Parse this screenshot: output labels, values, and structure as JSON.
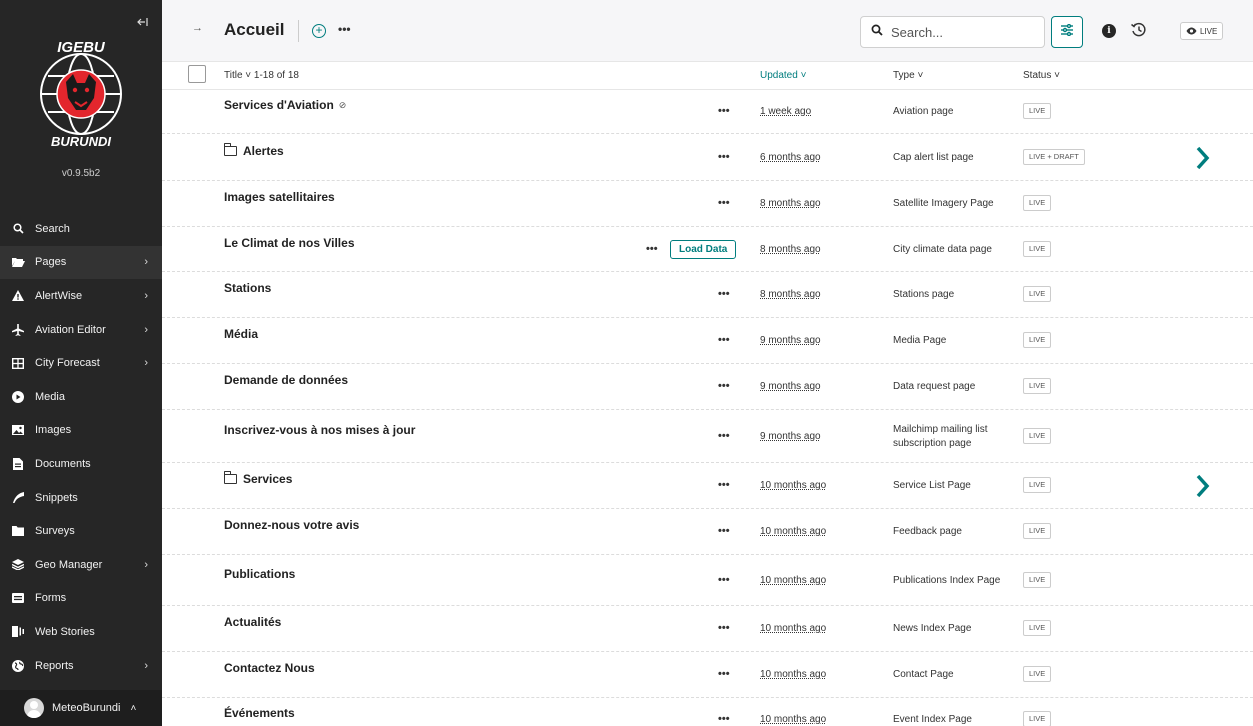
{
  "sidebar": {
    "collapse_icon": "collapse-left-icon",
    "logo_top_text": "IGEBU",
    "logo_bottom_text": "BURUNDI",
    "version": "v0.9.5b2",
    "items": [
      {
        "label": "Search",
        "icon": "search-icon",
        "chevron": false
      },
      {
        "label": "Pages",
        "icon": "folder-open-icon",
        "chevron": true
      },
      {
        "label": "AlertWise",
        "icon": "warning-icon",
        "chevron": true
      },
      {
        "label": "Aviation Editor",
        "icon": "plane-icon",
        "chevron": true
      },
      {
        "label": "City Forecast",
        "icon": "table-icon",
        "chevron": true
      },
      {
        "label": "Media",
        "icon": "media-icon",
        "chevron": false
      },
      {
        "label": "Images",
        "icon": "image-icon",
        "chevron": false
      },
      {
        "label": "Documents",
        "icon": "document-icon",
        "chevron": false
      },
      {
        "label": "Snippets",
        "icon": "snippet-icon",
        "chevron": false
      },
      {
        "label": "Surveys",
        "icon": "folder-icon",
        "chevron": false
      },
      {
        "label": "Geo Manager",
        "icon": "layers-icon",
        "chevron": true
      },
      {
        "label": "Forms",
        "icon": "form-icon",
        "chevron": false
      },
      {
        "label": "Web Stories",
        "icon": "stories-icon",
        "chevron": false
      },
      {
        "label": "Reports",
        "icon": "globe-icon",
        "chevron": true
      }
    ],
    "account_name": "MeteoBurundi"
  },
  "header": {
    "title": "Accueil",
    "search_placeholder": "Search...",
    "live_label": "LIVE",
    "info_glyph": "i"
  },
  "table": {
    "headers": {
      "title": "Title ˅ 1-18 of 18",
      "updated": "Updated ˅",
      "type": "Type ˅",
      "status": "Status ˅"
    },
    "rows": [
      {
        "title": "Services d'Aviation",
        "folder": false,
        "private": true,
        "updated": "1 week ago",
        "type": "Aviation page",
        "status": "LIVE",
        "children": false,
        "load": false
      },
      {
        "title": "Alertes",
        "folder": true,
        "private": false,
        "updated": "6 months ago",
        "type": "Cap alert list page",
        "status": "LIVE + DRAFT",
        "children": true,
        "load": false
      },
      {
        "title": "Images satellitaires",
        "folder": false,
        "private": false,
        "updated": "8 months ago",
        "type": "Satellite Imagery Page",
        "status": "LIVE",
        "children": false,
        "load": false
      },
      {
        "title": "Le Climat de nos Villes",
        "folder": false,
        "private": false,
        "updated": "8 months ago",
        "type": "City climate data page",
        "status": "LIVE",
        "children": false,
        "load": true,
        "load_label": "Load Data"
      },
      {
        "title": "Stations",
        "folder": false,
        "private": false,
        "updated": "8 months ago",
        "type": "Stations page",
        "status": "LIVE",
        "children": false,
        "load": false
      },
      {
        "title": "Média",
        "folder": false,
        "private": false,
        "updated": "9 months ago",
        "type": "Media Page",
        "status": "LIVE",
        "children": false,
        "load": false
      },
      {
        "title": "Demande de données",
        "folder": false,
        "private": false,
        "updated": "9 months ago",
        "type": "Data request page",
        "status": "LIVE",
        "children": false,
        "load": false
      },
      {
        "title": "Inscrivez-vous à nos mises à jour",
        "folder": false,
        "private": false,
        "updated": "9 months ago",
        "type": "Mailchimp mailing list subscription page",
        "status": "LIVE",
        "children": false,
        "load": false
      },
      {
        "title": "Services",
        "folder": true,
        "private": false,
        "updated": "10 months ago",
        "type": "Service List Page",
        "status": "LIVE",
        "children": true,
        "load": false
      },
      {
        "title": "Donnez-nous votre avis",
        "folder": false,
        "private": false,
        "updated": "10 months ago",
        "type": "Feedback page",
        "status": "LIVE",
        "children": false,
        "load": false
      },
      {
        "title": "Publications",
        "folder": false,
        "private": false,
        "updated": "10 months ago",
        "type": "Publications Index Page",
        "status": "LIVE",
        "children": false,
        "load": false
      },
      {
        "title": "Actualités",
        "folder": false,
        "private": false,
        "updated": "10 months ago",
        "type": "News Index Page",
        "status": "LIVE",
        "children": false,
        "load": false
      },
      {
        "title": "Contactez Nous",
        "folder": false,
        "private": false,
        "updated": "10 months ago",
        "type": "Contact Page",
        "status": "LIVE",
        "children": false,
        "load": false
      },
      {
        "title": "Événements",
        "folder": false,
        "private": false,
        "updated": "10 months ago",
        "type": "Event Index Page",
        "status": "LIVE",
        "children": false,
        "load": false
      }
    ]
  },
  "colors": {
    "accent": "#007d7e",
    "sidebar_bg": "#262626",
    "logo_red": "#e3262d"
  }
}
